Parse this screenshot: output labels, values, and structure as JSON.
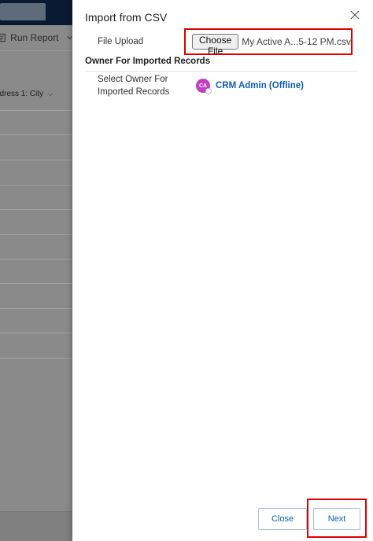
{
  "background": {
    "command": {
      "run_report_label": "Run Report"
    },
    "grid": {
      "column_header": "ddress 1: City"
    }
  },
  "dialog": {
    "title": "Import from CSV",
    "file_upload": {
      "label": "File Upload",
      "button_label": "Choose File",
      "file_name": "My Active A...5-12 PM.csv"
    },
    "owner_section": {
      "title": "Owner For Imported Records",
      "label_line1": "Select Owner For",
      "label_line2": "Imported Records",
      "avatar_initials": "CA",
      "owner_name": "CRM Admin (Offline)"
    },
    "footer": {
      "close_label": "Close",
      "next_label": "Next"
    }
  },
  "colors": {
    "accent": "#0f5fb5",
    "highlight": "#e00000",
    "avatar": "#c23fbd",
    "topbar": "#0b1a33"
  },
  "icons": [
    "close-icon",
    "run-report-icon",
    "chevron-down-icon"
  ]
}
